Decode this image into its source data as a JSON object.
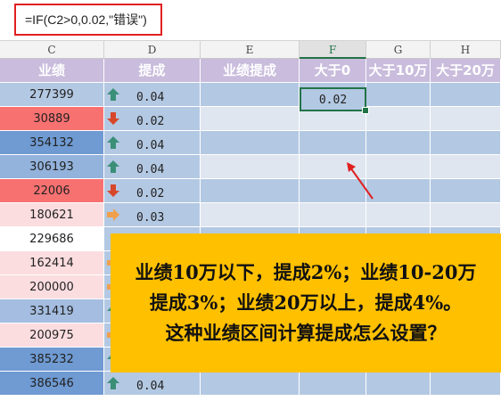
{
  "formula": "=IF(C2>0,0.02,\"错误\")",
  "columns": [
    "C",
    "D",
    "E",
    "F",
    "G",
    "H"
  ],
  "active_column": "F",
  "header_row": [
    "业绩",
    "提成",
    "业绩提成",
    "大于0",
    "大于10万",
    "大于20万"
  ],
  "rows": [
    {
      "value": "277399",
      "color": "#b3c8e2",
      "arrow": "up",
      "commission": "0.04"
    },
    {
      "value": "30889",
      "color": "#f87171",
      "arrow": "down",
      "commission": "0.02"
    },
    {
      "value": "354132",
      "color": "#6f9ad2",
      "arrow": "up",
      "commission": "0.04"
    },
    {
      "value": "306193",
      "color": "#93b2dc",
      "arrow": "up",
      "commission": "0.04"
    },
    {
      "value": "22006",
      "color": "#f87171",
      "arrow": "down",
      "commission": "0.02"
    },
    {
      "value": "180621",
      "color": "#fbdde0",
      "arrow": "side",
      "commission": "0.03"
    },
    {
      "value": "229686",
      "color": "#ffffff",
      "arrow": "",
      "commission": ""
    },
    {
      "value": "162414",
      "color": "#fbdde0",
      "arrow": "side",
      "commission": ""
    },
    {
      "value": "200000",
      "color": "#fbdde0",
      "arrow": "side",
      "commission": ""
    },
    {
      "value": "331419",
      "color": "#a4bde0",
      "arrow": "up",
      "commission": ""
    },
    {
      "value": "200975",
      "color": "#fbdde0",
      "arrow": "side",
      "commission": ""
    },
    {
      "value": "385232",
      "color": "#6f9ad2",
      "arrow": "up",
      "commission": ""
    },
    {
      "value": "386546",
      "color": "#6f9ad2",
      "arrow": "up",
      "commission": "0.04"
    }
  ],
  "active_cell_value": "0.02",
  "banner_lines": [
    "业绩10万以下，提成2%；业绩10-20万",
    "提成3%；业绩20万以上，提成4%。",
    "这种业绩区间计算提成怎么设置？"
  ],
  "colors": {
    "header_purple": "#c9bcdc",
    "arrow_up": "#3a8f77",
    "arrow_down": "#d7472a",
    "arrow_side": "#f0a04a",
    "banner": "#ffc000",
    "selection": "#217346",
    "annotation_red": "#e02020"
  }
}
